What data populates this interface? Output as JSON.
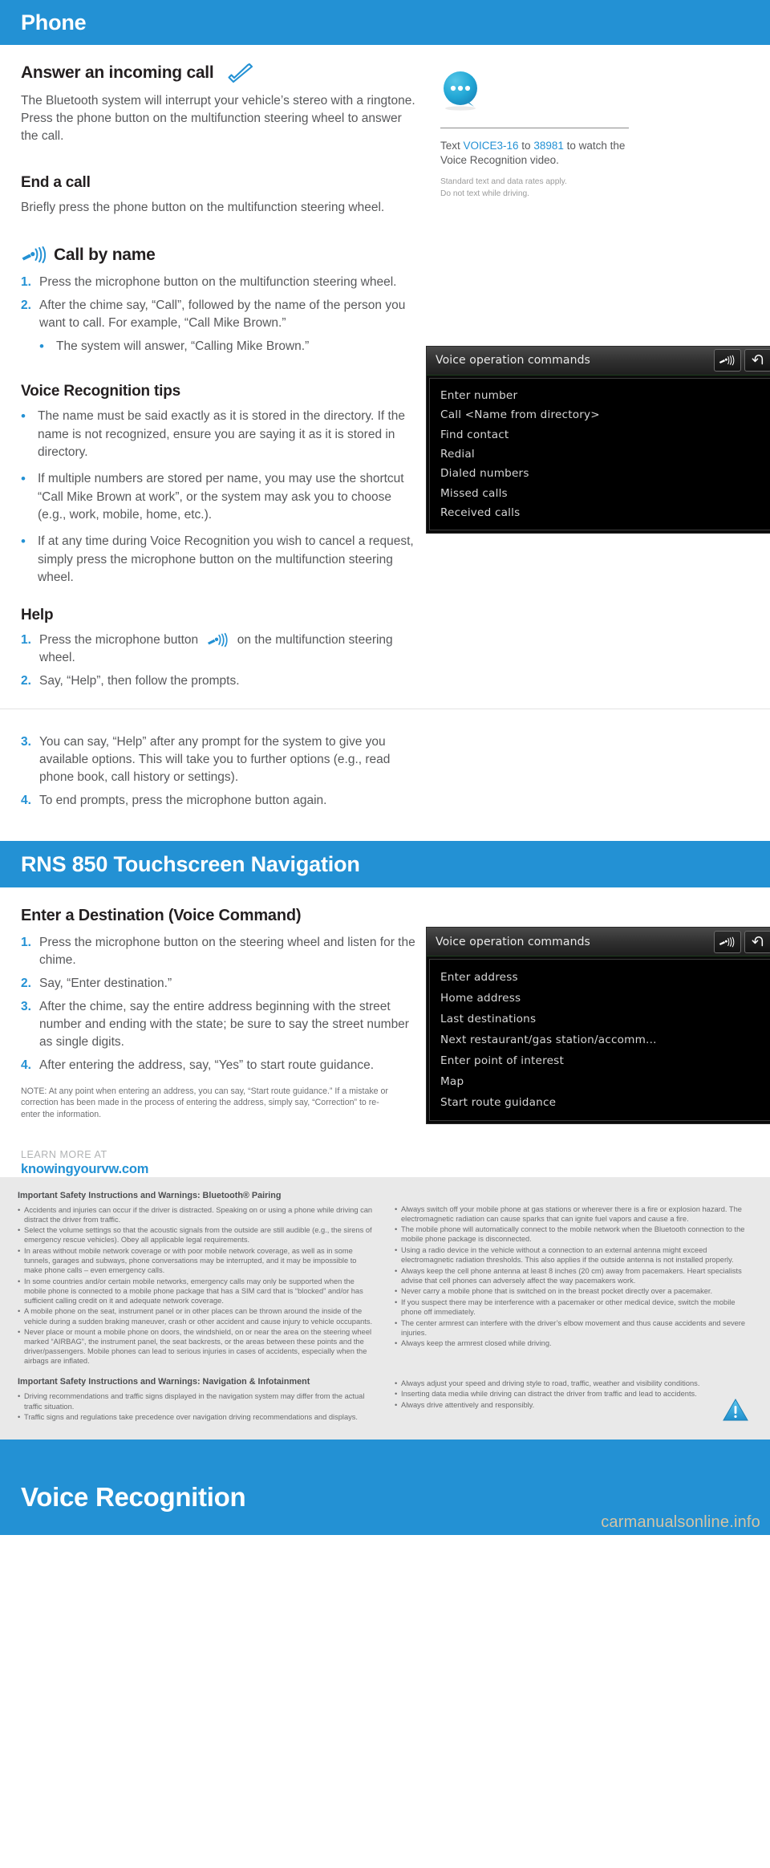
{
  "phone_section": {
    "banner_title": "Phone",
    "answer": {
      "heading": "Answer an incoming call",
      "body": "The Bluetooth system will interrupt your vehicle’s stereo with a ringtone. Press the phone button on the multifunction steering wheel to answer the call."
    },
    "end_call": {
      "heading": "End a call",
      "body": "Briefly press the phone button on the multifunction steering wheel."
    },
    "call_by_name": {
      "heading": "Call by name",
      "steps": [
        {
          "num": "1.",
          "text": "Press the microphone button on the multifunction steering wheel."
        },
        {
          "num": "2.",
          "text": "After the chime say, “Call”, followed by the name of the person you want to call. For example, “Call Mike Brown.”"
        }
      ],
      "subbullet": "The system will answer, “Calling Mike Brown.”"
    },
    "tips": {
      "heading": "Voice Recognition tips",
      "bullets": [
        "The name must be said exactly as it is stored in the directory. If the name is not recognized, ensure you are saying it as it is stored in directory.",
        "If multiple numbers are stored per name, you may use the shortcut “Call Mike Brown at work”, or the system may ask you to choose (e.g., work, mobile, home, etc.).",
        "If at any time during Voice Recognition you wish to cancel a request, simply press the microphone button on the multifunction steering wheel."
      ]
    },
    "help": {
      "heading": "Help",
      "step1_pre": "Press the microphone button",
      "step1_post": "on the multifunction steering wheel.",
      "step1_num": "1.",
      "steps_after": [
        {
          "num": "2.",
          "text": "Say, “Help”, then follow the prompts."
        }
      ],
      "steps_below_rule": [
        {
          "num": "3.",
          "text": "You can say, “Help” after any prompt for the system to give you available options. This will take you to further options (e.g., read phone book, call history or settings)."
        },
        {
          "num": "4.",
          "text": "To end prompts, press the microphone button again."
        }
      ]
    },
    "callout": {
      "icon": "speech-bubble-icon",
      "text_prefix": "Text ",
      "code": "VOICE3-16",
      "mid": " to ",
      "shortcode": "38981",
      "text_suffix": " to watch the Voice Recognition video.",
      "fine1": "Standard text and data rates apply.",
      "fine2": "Do not text while driving."
    },
    "screen": {
      "title": "Voice operation commands",
      "commands": [
        "Enter number",
        "Call <Name from directory>",
        "Find contact",
        "Redial",
        "Dialed numbers",
        "Missed calls",
        "Received calls"
      ]
    }
  },
  "rns_section": {
    "banner_title": "RNS 850 Touchscreen Navigation",
    "destination": {
      "heading": "Enter a Destination (Voice Command)",
      "steps": [
        {
          "num": "1.",
          "text": "Press the microphone button on the steering wheel and listen for the chime."
        },
        {
          "num": "2.",
          "text": "Say, “Enter destination.”"
        },
        {
          "num": "3.",
          "text": "After the chime, say the entire address beginning with the street number and ending with the state; be sure to say the street number as single digits."
        },
        {
          "num": "4.",
          "text": "After entering the address, say, “Yes” to start route guidance."
        }
      ]
    },
    "note": "NOTE: At any point when entering an address, you can say, “Start route guidance.” If a mistake or correction has been made in the process of entering the address, simply say, “Correction” to re-enter the information.",
    "learn_more": {
      "label": "LEARN MORE AT",
      "url": "knowingyourvw.com"
    },
    "screen": {
      "title": "Voice operation commands",
      "commands": [
        "Enter address",
        "Home address",
        "Last destinations",
        "Next restaurant/gas station/accomm...",
        "Enter point of interest",
        "Map",
        "Start route guidance"
      ]
    }
  },
  "safety": {
    "bluetooth_heading": "Important Safety Instructions and Warnings: Bluetooth® Pairing",
    "bluetooth_left": [
      "Accidents and injuries can occur if the driver is distracted. Speaking on or using a phone while driving can distract the driver from traffic.",
      "Select the volume settings so that the acoustic signals from the outside are still audible (e.g., the sirens of emergency rescue vehicles). Obey all applicable legal requirements.",
      "In areas without mobile network coverage or with poor mobile network coverage, as well as in some tunnels, garages and subways, phone conversations may be interrupted, and it may be impossible to make phone calls – even emergency calls.",
      "In some countries and/or certain mobile networks, emergency calls may only be supported when the mobile phone is connected to a mobile phone package that has a SIM card that is “blocked” and/or has sufficient calling credit on it and adequate network coverage.",
      "A mobile phone on the seat, instrument panel or in other places can be thrown around the inside of the vehicle during a sudden braking maneuver, crash or other accident and cause injury to vehicle occupants.",
      "Never place or mount a mobile phone on doors, the windshield, on or near the area on the steering wheel marked “AIRBAG”, the instrument panel, the seat backrests, or the areas between these points and the driver/passengers. Mobile phones can lead to serious injuries in cases of accidents, especially when the airbags are inflated."
    ],
    "bluetooth_right": [
      "Always switch off your mobile phone at gas stations or wherever there is a fire or explosion hazard. The electromagnetic radiation can cause sparks that can ignite fuel vapors and cause a fire.",
      "The mobile phone will automatically connect to the mobile network when the Bluetooth connection to the mobile phone package is disconnected.",
      "Using a radio device in the vehicle without a connection to an external antenna might exceed electromagnetic radiation thresholds. This also applies if the outside antenna is not installed properly.",
      "Always keep the cell phone antenna at least 8 inches (20 cm) away from pacemakers. Heart specialists advise that cell phones can adversely affect the way pacemakers work.",
      "Never carry a mobile phone that is switched on in the breast pocket directly over a pacemaker.",
      "If you suspect there may be interference with a pacemaker or other medical device, switch the mobile phone off immediately.",
      "The center armrest can interfere with the driver’s elbow movement and thus cause accidents and severe injuries.",
      "Always keep the armrest closed while driving."
    ],
    "nav_heading": "Important Safety Instructions and Warnings: Navigation & Infotainment",
    "nav_left": [
      "Driving recommendations and traffic signs displayed in the navigation system may differ from the actual traffic situation.",
      "Traffic signs and regulations take precedence over navigation driving recommendations and displays."
    ],
    "nav_right": [
      "Always adjust your speed and driving style to road, traffic, weather and visibility conditions.",
      "Inserting data media while driving can distract the driver from traffic and lead to accidents.",
      "Always drive attentively and responsibly."
    ]
  },
  "bottom": {
    "title": "Voice Recognition",
    "watermark": "carmanualsonline.info"
  },
  "colors": {
    "accent": "#2391d4",
    "body_text": "#58595b",
    "heading_text": "#231f20",
    "footer_bg": "#e9e9e9"
  }
}
